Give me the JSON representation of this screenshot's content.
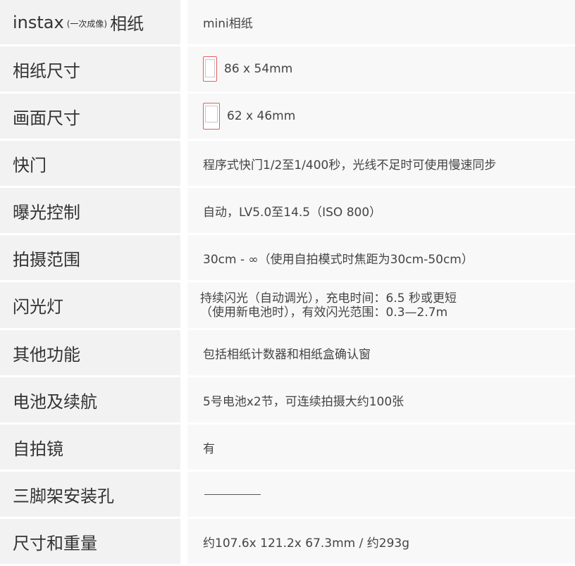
{
  "colors": {
    "label_bg": "#f2f2f2",
    "value_bg": "#f8f8f8",
    "film_border": "#e06060",
    "text": "#333333"
  },
  "rows": [
    {
      "label_main": "instax",
      "label_sub": "(一次成像)",
      "label_tail": "相纸",
      "value": "mini相纸"
    },
    {
      "label": "相纸尺寸",
      "icon": "film-card-icon",
      "value": "86 x 54mm"
    },
    {
      "label": "画面尺寸",
      "icon": "film-image-icon",
      "value": "62 x 46mm"
    },
    {
      "label": "快门",
      "value": "程序式快门1/2至1/400秒，光线不足时可使用慢速同步"
    },
    {
      "label": "曝光控制",
      "value": "自动，LV5.0至14.5（ISO 800）"
    },
    {
      "label": "拍摄范围",
      "value": "30cm - ∞（使用自拍模式时焦距为30cm-50cm）"
    },
    {
      "label": "闪光灯",
      "value_line1": "持续闪光（自动调光），充电时间：6.5 秒或更短",
      "value_line2": "（使用新电池时），有效闪光范围：0.3—2.7m"
    },
    {
      "label": "其他功能",
      "value": "包括相纸计数器和相纸盒确认窗"
    },
    {
      "label": "电池及续航",
      "value": "5号电池x2节，可连续拍摄大约100张"
    },
    {
      "label": "自拍镜",
      "value": "有"
    },
    {
      "label": "三脚架安装孔",
      "value_icon": "dash-line"
    },
    {
      "label": "尺寸和重量",
      "value": "约107.6x 121.2x 67.3mm / 约293g"
    }
  ]
}
